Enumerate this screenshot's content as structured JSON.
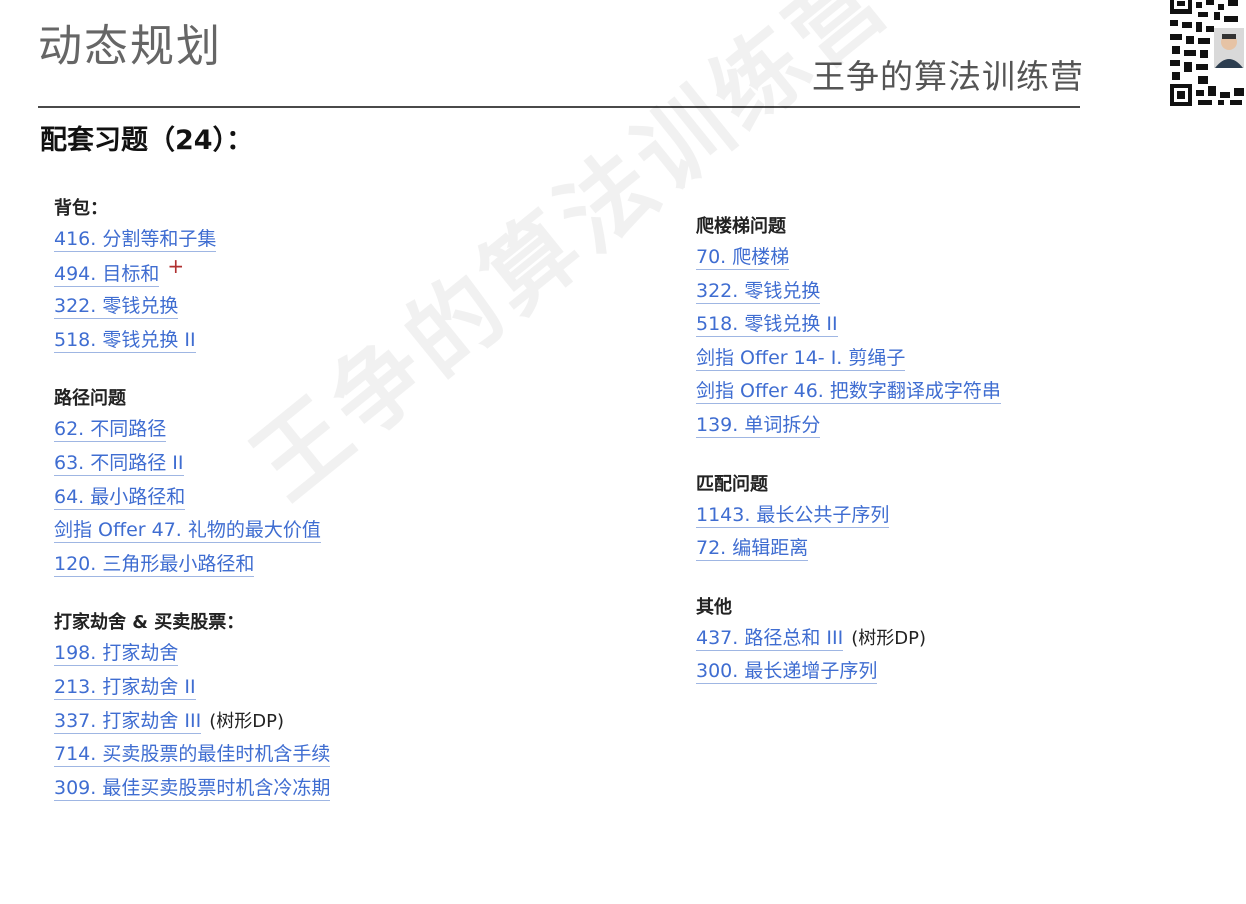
{
  "header": {
    "title": "动态规划",
    "brand": "王争的算法训练营",
    "subtitle": "配套习题（24）：",
    "watermark": "王争的算法训练营"
  },
  "left_sections": [
    {
      "title": "背包：",
      "items": [
        {
          "text": "416. 分割等和子集",
          "note": ""
        },
        {
          "text": "494. 目标和",
          "note": "",
          "mark": "+"
        },
        {
          "text": "322. 零钱兑换",
          "note": ""
        },
        {
          "text": "518. 零钱兑换 II",
          "note": ""
        }
      ]
    },
    {
      "title": "路径问题",
      "items": [
        {
          "text": "62. 不同路径",
          "note": ""
        },
        {
          "text": "63. 不同路径 II",
          "note": ""
        },
        {
          "text": "64. 最小路径和",
          "note": ""
        },
        {
          "text": "剑指 Offer 47. 礼物的最大价值",
          "note": ""
        },
        {
          "text": "120. 三角形最小路径和",
          "note": ""
        }
      ]
    },
    {
      "title": "打家劫舍 & 买卖股票：",
      "items": [
        {
          "text": "198. 打家劫舍",
          "note": ""
        },
        {
          "text": "213. 打家劫舍 II",
          "note": ""
        },
        {
          "text": "337. 打家劫舍 III",
          "note": "(树形DP)"
        },
        {
          "text": "714. 买卖股票的最佳时机含手续",
          "note": ""
        },
        {
          "text": "309. 最佳买卖股票时机含冷冻期",
          "note": ""
        }
      ]
    }
  ],
  "right_sections": [
    {
      "title": "爬楼梯问题",
      "items": [
        {
          "text": "70. 爬楼梯",
          "note": ""
        },
        {
          "text": "322. 零钱兑换",
          "note": ""
        },
        {
          "text": "518. 零钱兑换 II",
          "note": ""
        },
        {
          "text": "剑指 Offer 14- I. 剪绳子",
          "note": ""
        },
        {
          "text": "剑指 Offer 46. 把数字翻译成字符串",
          "note": ""
        },
        {
          "text": "139. 单词拆分",
          "note": ""
        }
      ]
    },
    {
      "title": "匹配问题",
      "items": [
        {
          "text": "1143. 最长公共子序列",
          "note": ""
        },
        {
          "text": "72. 编辑距离",
          "note": ""
        }
      ]
    },
    {
      "title": "其他",
      "items": [
        {
          "text": "437. 路径总和 III",
          "note": "(树形DP)"
        },
        {
          "text": "300. 最长递增子序列",
          "note": ""
        }
      ]
    }
  ],
  "colors": {
    "link": "#3f6dd1",
    "title_gray": "#666666"
  }
}
